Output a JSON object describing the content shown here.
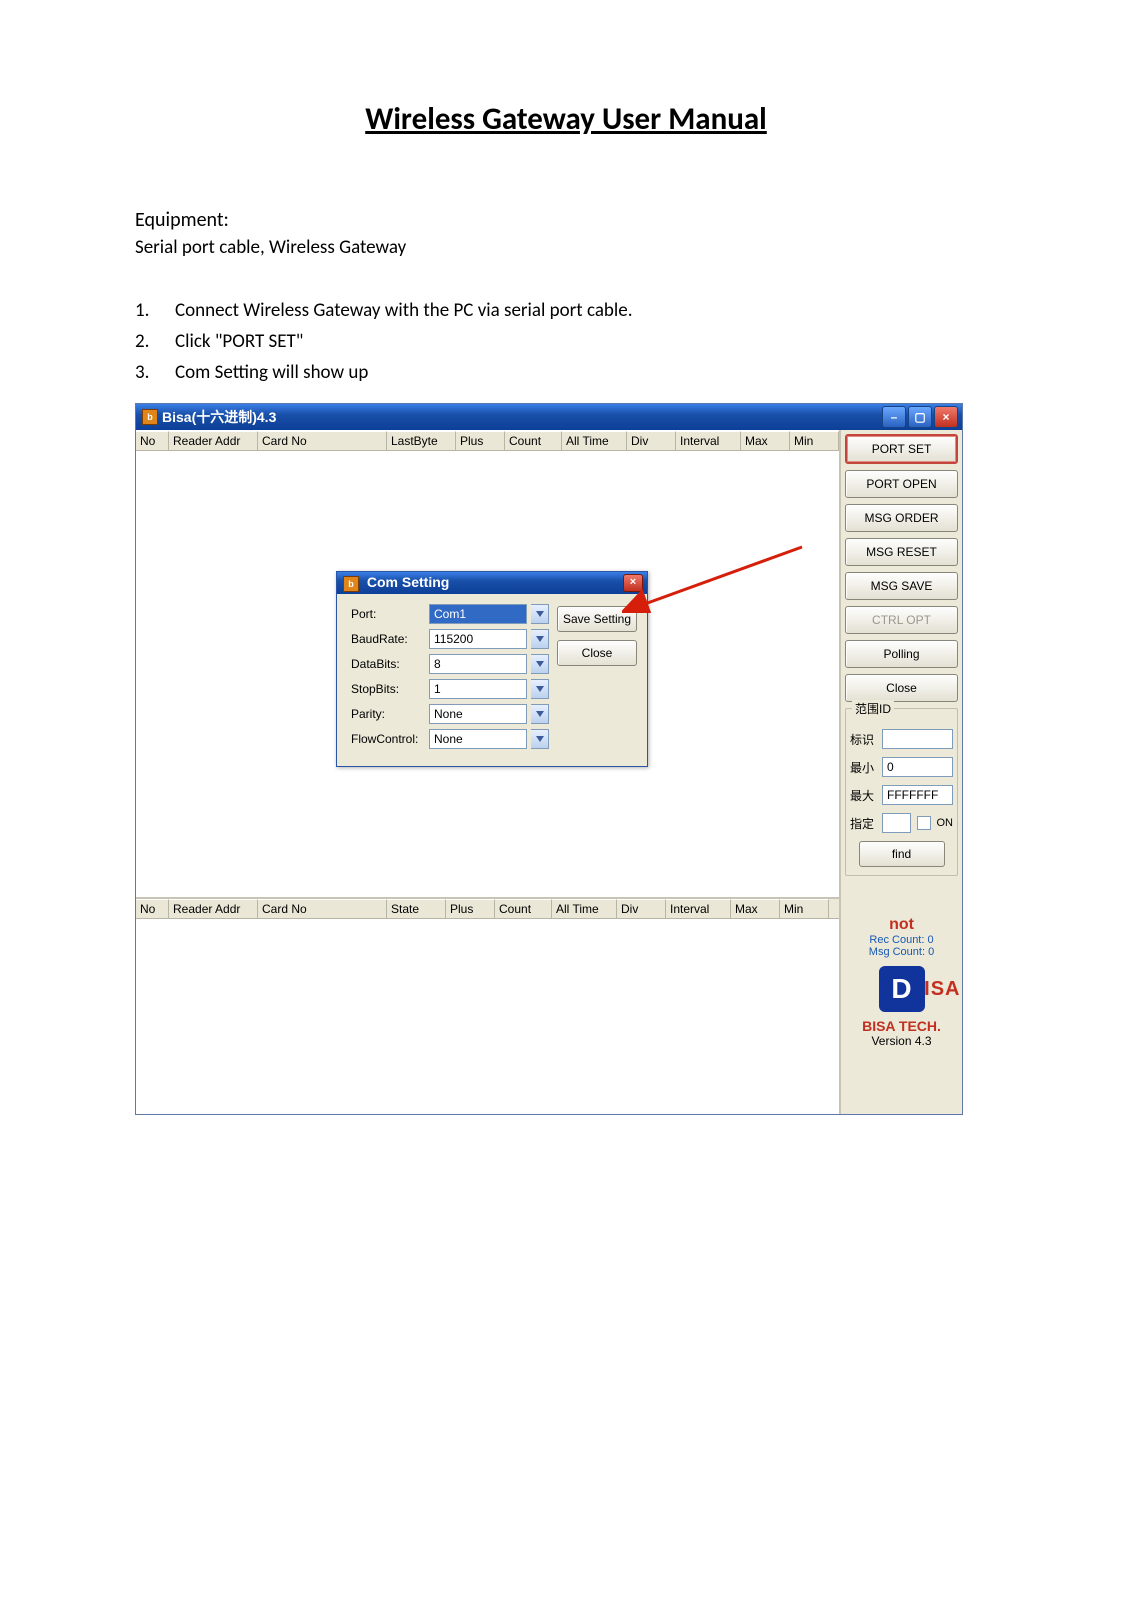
{
  "document": {
    "title": "Wireless Gateway User Manual",
    "equipment_label": "Equipment:",
    "equipment_text": "Serial port cable, Wireless Gateway",
    "steps": [
      "Connect Wireless Gateway with the PC via serial port cable.",
      "Click \"PORT SET\"",
      "Com Setting will show up"
    ]
  },
  "app": {
    "title": "Bisa(十六进制)4.3",
    "window_controls": {
      "min": "–",
      "max": "▢",
      "close": "×"
    },
    "columns_top": [
      "No",
      "Reader Addr",
      "Card No",
      "LastByte",
      "Plus",
      "Count",
      "All Time",
      "Div",
      "Interval",
      "Max",
      "Min"
    ],
    "columns_bottom": [
      "No",
      "Reader Addr",
      "Card No",
      "State",
      "Plus",
      "Count",
      "All Time",
      "Div",
      "Interval",
      "Max",
      "Min"
    ],
    "sidebar": {
      "buttons": [
        "PORT  SET",
        "PORT OPEN",
        "MSG ORDER",
        "MSG RESET",
        "MSG SAVE",
        "CTRL OPT",
        "Polling",
        "Close"
      ],
      "range": {
        "title": "范围ID",
        "label_tag": "标识",
        "label_min": "最小",
        "label_max": "最大",
        "label_spec": "指定",
        "val_tag": "",
        "val_min": "0",
        "val_max": "FFFFFFF",
        "val_spec": "",
        "on_label": "ON",
        "find": "find"
      },
      "status": {
        "not": "not",
        "rec_count": "Rec Count: 0",
        "msg_count": "Msg Count: 0",
        "brand": "BISA TECH.",
        "version": "Version 4.3"
      }
    },
    "com_dialog": {
      "title": "Com Setting",
      "fields": {
        "port_lbl": "Port:",
        "port_val": "Com1",
        "baud_lbl": "BaudRate:",
        "baud_val": "115200",
        "data_lbl": "DataBits:",
        "data_val": "8",
        "stop_lbl": "StopBits:",
        "stop_val": "1",
        "parity_lbl": "Parity:",
        "parity_val": "None",
        "flow_lbl": "FlowControl:",
        "flow_val": "None"
      },
      "buttons": {
        "save": "Save Setting",
        "close": "Close"
      }
    }
  }
}
